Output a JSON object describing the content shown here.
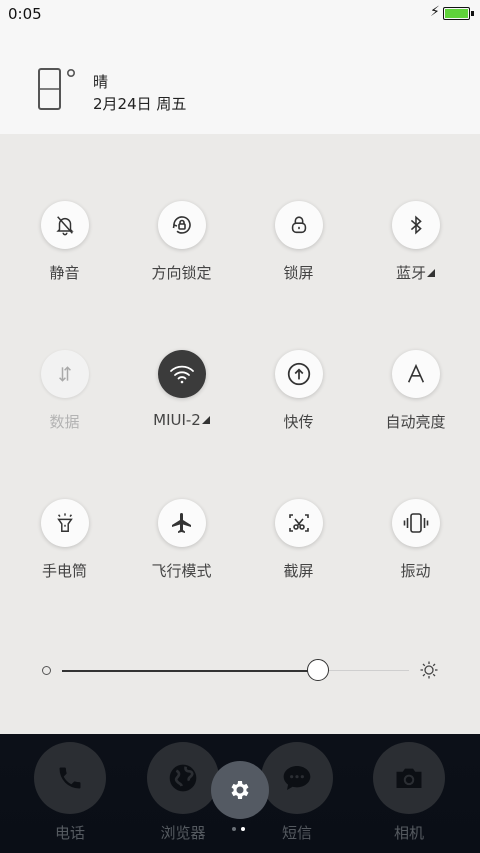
{
  "status_bar": {
    "time": "0:05",
    "battery_level": 1.0,
    "battery_color": "#5fd23a"
  },
  "weather": {
    "condition": "晴",
    "date": "2月24日 周五"
  },
  "toggles": [
    {
      "label": "静音",
      "icon": "bell-off-icon",
      "state": "off"
    },
    {
      "label": "方向锁定",
      "icon": "rotation-lock-icon",
      "state": "off"
    },
    {
      "label": "锁屏",
      "icon": "lock-icon",
      "state": "off"
    },
    {
      "label": "蓝牙",
      "icon": "bluetooth-icon",
      "state": "off",
      "has_submenu": true
    },
    {
      "label": "数据",
      "icon": "mobile-data-icon",
      "state": "disabled"
    },
    {
      "label": "MIUI-2",
      "icon": "wifi-icon",
      "state": "on",
      "has_submenu": true
    },
    {
      "label": "快传",
      "icon": "upload-circle-icon",
      "state": "off"
    },
    {
      "label": "自动亮度",
      "icon": "auto-brightness-icon",
      "state": "off"
    },
    {
      "label": "手电筒",
      "icon": "flashlight-icon",
      "state": "off"
    },
    {
      "label": "飞行模式",
      "icon": "airplane-icon",
      "state": "off"
    },
    {
      "label": "截屏",
      "icon": "screenshot-icon",
      "state": "off"
    },
    {
      "label": "振动",
      "icon": "vibrate-icon",
      "state": "off"
    }
  ],
  "brightness": {
    "level": 0.737
  },
  "dock": {
    "apps": [
      {
        "label": "电话",
        "icon": "phone-icon"
      },
      {
        "label": "浏览器",
        "icon": "browser-icon"
      },
      {
        "label": "短信",
        "icon": "message-icon"
      },
      {
        "label": "相机",
        "icon": "camera-icon"
      }
    ],
    "settings_icon": "gear-icon",
    "page_count": 2,
    "current_page": 2
  }
}
